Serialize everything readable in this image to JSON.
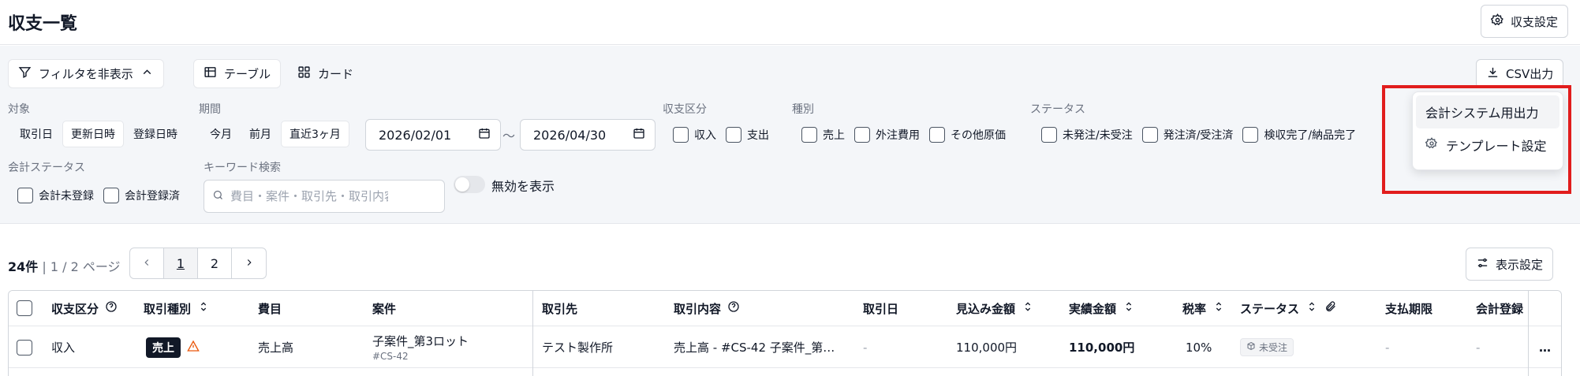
{
  "page": {
    "title": "収支一覧",
    "settings_button": "収支設定"
  },
  "toolbar": {
    "filter_toggle": "フィルタを非表示",
    "view_table": "テーブル",
    "view_card": "カード",
    "csv_export": "CSV出力"
  },
  "dropdown": {
    "items": [
      {
        "label": "会計システム用出力"
      },
      {
        "label": "テンプレート設定"
      }
    ]
  },
  "filters": {
    "target": {
      "label": "対象",
      "options": [
        "取引日",
        "更新日時",
        "登録日時"
      ],
      "selected": "更新日時"
    },
    "period": {
      "label": "期間",
      "options": [
        "今月",
        "前月",
        "直近3ヶ月"
      ],
      "selected": "直近3ヶ月"
    },
    "date_from": "2026/02/01",
    "date_tilde": "～",
    "date_to": "2026/04/30",
    "income_type": {
      "label": "収支区分",
      "options": [
        "収入",
        "支出"
      ]
    },
    "kind": {
      "label": "種別",
      "options": [
        "売上",
        "外注費用",
        "その他原価"
      ]
    },
    "status": {
      "label": "ステータス",
      "options": [
        "未発注/未受注",
        "発注済/受注済",
        "検収完了/納品完了"
      ]
    },
    "accounting_status": {
      "label": "会計ステータス",
      "options": [
        "会計未登録",
        "会計登録済"
      ]
    },
    "keyword": {
      "label": "キーワード検索",
      "placeholder": "費目・案件・取引先・取引内容"
    },
    "show_inactive": {
      "label": "無効を表示",
      "on": false
    }
  },
  "list_meta": {
    "count": "24件",
    "sep": " | ",
    "pages": "1 / 2 ページ"
  },
  "pager": {
    "pages": [
      "1",
      "2"
    ],
    "current": "1"
  },
  "display_settings": "表示設定",
  "table": {
    "headers": {
      "income_type": "収支区分",
      "transaction_kind": "取引種別",
      "expense_item": "費目",
      "project": "案件",
      "partner": "取引先",
      "content": "取引内容",
      "date": "取引日",
      "expected": "見込み金額",
      "actual": "実績金額",
      "tax": "税率",
      "status": "ステータス",
      "due": "支払期限",
      "accounting": "会計登録"
    },
    "rows": [
      {
        "income_type": "収入",
        "kind_badge": "売上",
        "expense_item": "売上高",
        "project_name": "子案件_第3ロット",
        "project_code": "#CS-42",
        "partner": "テスト製作所",
        "content": "売上高 - #CS-42 子案件_第…",
        "date": "-",
        "expected": "110,000円",
        "actual": "110,000円",
        "tax": "10%",
        "status": "未受注",
        "due": "-",
        "accounting": "-",
        "more": "…"
      }
    ]
  }
}
